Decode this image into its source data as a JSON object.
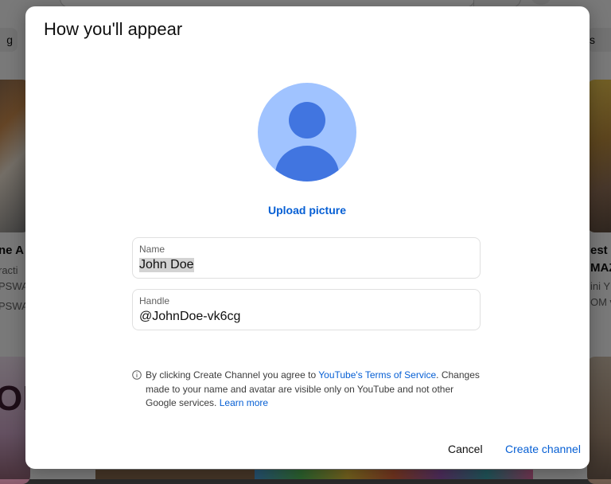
{
  "dialog": {
    "title": "How you'll appear",
    "upload_label": "Upload picture",
    "name_field": {
      "label": "Name",
      "value": "John Doe"
    },
    "handle_field": {
      "label": "Handle",
      "value": "@JohnDoe-vk6cg"
    },
    "notice": {
      "part1": "By clicking Create Channel you agree to ",
      "tos_link": "YouTube's Terms of Service",
      "part2": ". Changes made to your name and avatar are visible only on YouTube and not other Google services. ",
      "learn_more": "Learn more"
    },
    "cancel_label": "Cancel",
    "create_label": "Create channel"
  },
  "background": {
    "chip_left": "g",
    "chip_right": "s",
    "left_title": "ne A",
    "left_meta1": "racti",
    "left_meta2": "PSWA",
    "left_meta3": "PSWA",
    "right_title1": "est c",
    "right_title2": "MAZ",
    "right_meta1": "ini Y",
    "right_meta2": "OM vi",
    "left_thumb_text": "OK"
  },
  "colors": {
    "accent_link": "#065fd4",
    "avatar_bg": "#a0c3ff",
    "avatar_fg": "#4175e0"
  }
}
